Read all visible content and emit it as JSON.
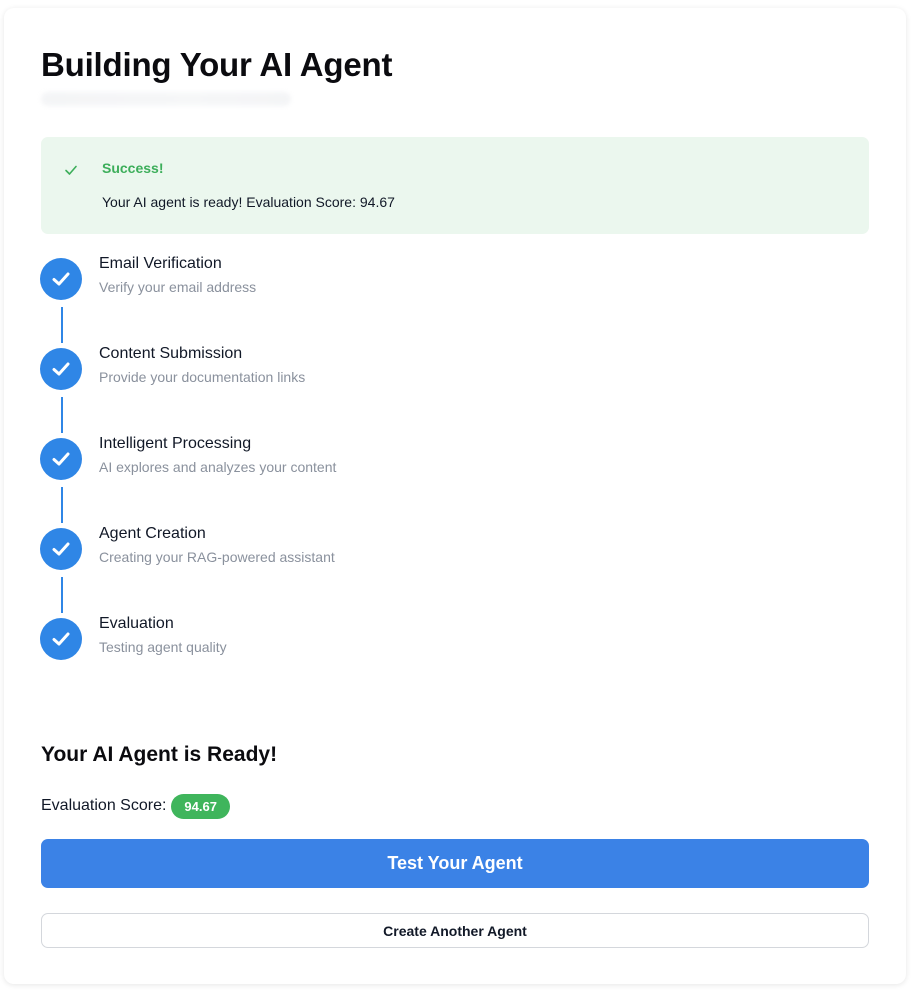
{
  "page": {
    "title": "Building Your AI Agent"
  },
  "alert": {
    "icon": "check-icon",
    "title": "Success!",
    "message": "Your AI agent is ready! Evaluation Score: 94.67",
    "colors": {
      "background": "#ebf7ee",
      "accent": "#3cae5a"
    }
  },
  "steps": [
    {
      "title": "Email Verification",
      "description": "Verify your email address",
      "status": "completed",
      "icon": "check-icon"
    },
    {
      "title": "Content Submission",
      "description": "Provide your documentation links",
      "status": "completed",
      "icon": "check-icon"
    },
    {
      "title": "Intelligent Processing",
      "description": "AI explores and analyzes your content",
      "status": "completed",
      "icon": "check-icon"
    },
    {
      "title": "Agent Creation",
      "description": "Creating your RAG-powered assistant",
      "status": "completed",
      "icon": "check-icon"
    },
    {
      "title": "Evaluation",
      "description": "Testing agent quality",
      "status": "completed",
      "icon": "check-icon"
    }
  ],
  "result": {
    "title": "Your AI Agent is Ready!",
    "score_label": "Evaluation Score:",
    "score_value": "94.67"
  },
  "actions": {
    "test_label": "Test Your Agent",
    "create_another_label": "Create Another Agent"
  },
  "colors": {
    "primary": "#3b82e6",
    "step_circle": "#2f86e6",
    "success": "#3fb55c"
  }
}
